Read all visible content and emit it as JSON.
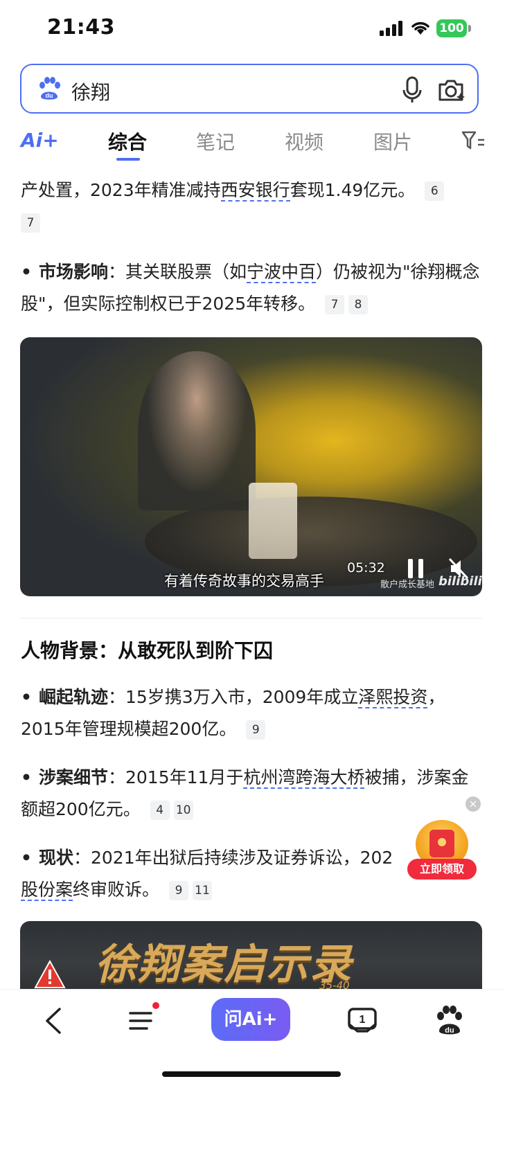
{
  "status": {
    "time": "21:43",
    "battery": "100"
  },
  "search": {
    "query": "徐翔"
  },
  "tabs": {
    "ai_label": "Ai+",
    "items": [
      "综合",
      "笔记",
      "视频",
      "图片"
    ]
  },
  "paragraphs": {
    "p1_line": "产处置，2023年精准减持西安银行套现1.49亿元。",
    "p1_prefix": "产处置，2023年精准减持",
    "p1_link": "西安银行",
    "p1_suffix": "套现1.49亿元。",
    "p1_cites": [
      "6",
      "7"
    ],
    "p2_term": "市场影响",
    "p2_a": "：其关联股票（如",
    "p2_link": "宁波中百",
    "p2_b": "）仍被视为\"徐翔概念股\"，但实际控制权已于2025年转移。",
    "p2_cites": [
      "7",
      "8"
    ]
  },
  "video": {
    "caption": "有着传奇故事的交易高手",
    "duration": "05:32",
    "watermark": "散户成长基地",
    "platform": "bilibili"
  },
  "section": {
    "heading": "人物背景：从敢死队到阶下囚",
    "items": [
      {
        "term": "崛起轨迹",
        "a": "：15岁携3万入市，2009年成立",
        "link": "泽熙投资",
        "b": "，2015年管理规模超200亿。",
        "cites": [
          "9"
        ]
      },
      {
        "term": "涉案细节",
        "a": "：2015年11月于",
        "link": "杭州湾跨海大桥",
        "b": "被捕，涉案金额超200亿元。",
        "cites": [
          "4",
          "10"
        ]
      },
      {
        "term": "现状",
        "a": "：2021年出狱后持续涉及证券诉讼，202",
        "link": "股份案",
        "b": "终审败诉。",
        "cites": [
          "9",
          "11"
        ]
      }
    ]
  },
  "banner": {
    "title": "徐翔案启示录",
    "sub": "35-40"
  },
  "red_packet": {
    "label": "立即领取"
  },
  "bottom": {
    "ask_label": "问Ai+"
  },
  "colors": {
    "accent": "#4e6ef2",
    "red": "#f02b3c",
    "battery": "#34c759"
  }
}
